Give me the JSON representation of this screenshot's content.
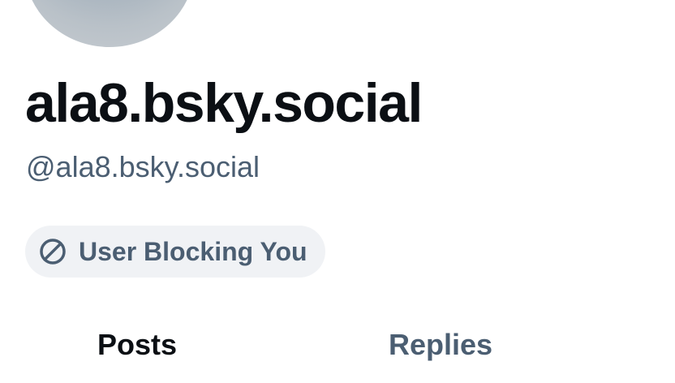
{
  "profile": {
    "display_name": "ala8.bsky.social",
    "handle": "@ala8.bsky.social",
    "status_label": "User Blocking You",
    "status_icon": "block-icon"
  },
  "tabs": [
    {
      "label": "Posts",
      "active": true
    },
    {
      "label": "Replies",
      "active": false
    }
  ],
  "colors": {
    "primary_text": "#0b0f14",
    "secondary_text": "#4b5e72",
    "pill_background": "#f0f2f5"
  }
}
